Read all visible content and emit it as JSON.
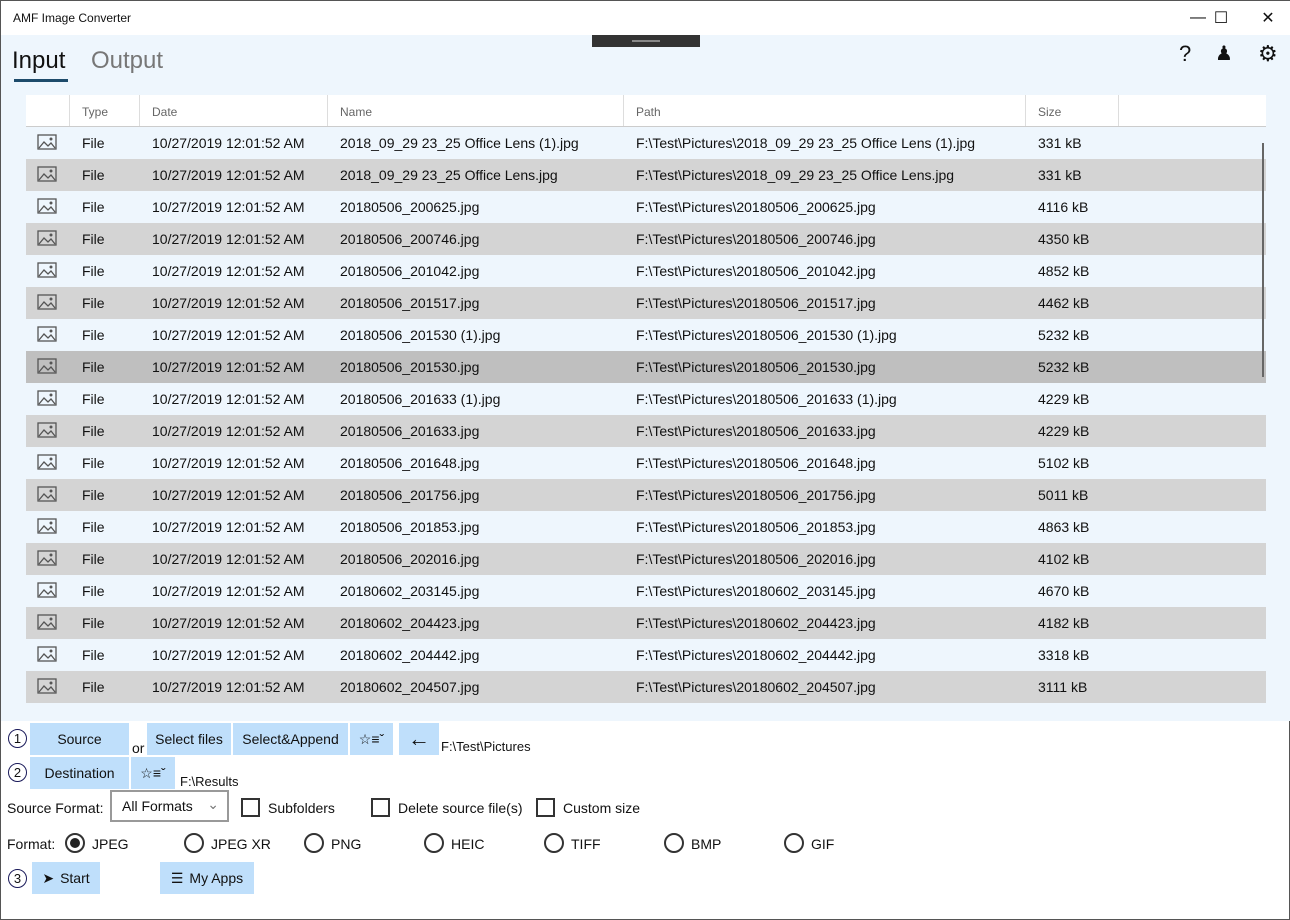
{
  "window": {
    "title": "AMF Image Converter"
  },
  "tabs": [
    {
      "label": "Input"
    },
    {
      "label": "Output"
    }
  ],
  "columns": [
    "",
    "Type",
    "Date",
    "Name",
    "Path",
    "Size"
  ],
  "rows": [
    [
      "File",
      "10/27/2019 12:01:52 AM",
      "2018_09_29 23_25 Office Lens (1).jpg",
      "F:\\Test\\Pictures\\2018_09_29 23_25 Office Lens (1).jpg",
      "331 kB"
    ],
    [
      "File",
      "10/27/2019 12:01:52 AM",
      "2018_09_29 23_25 Office Lens.jpg",
      "F:\\Test\\Pictures\\2018_09_29 23_25 Office Lens.jpg",
      "331 kB"
    ],
    [
      "File",
      "10/27/2019 12:01:52 AM",
      "20180506_200625.jpg",
      "F:\\Test\\Pictures\\20180506_200625.jpg",
      "4116 kB"
    ],
    [
      "File",
      "10/27/2019 12:01:52 AM",
      "20180506_200746.jpg",
      "F:\\Test\\Pictures\\20180506_200746.jpg",
      "4350 kB"
    ],
    [
      "File",
      "10/27/2019 12:01:52 AM",
      "20180506_201042.jpg",
      "F:\\Test\\Pictures\\20180506_201042.jpg",
      "4852 kB"
    ],
    [
      "File",
      "10/27/2019 12:01:52 AM",
      "20180506_201517.jpg",
      "F:\\Test\\Pictures\\20180506_201517.jpg",
      "4462 kB"
    ],
    [
      "File",
      "10/27/2019 12:01:52 AM",
      "20180506_201530 (1).jpg",
      "F:\\Test\\Pictures\\20180506_201530 (1).jpg",
      "5232 kB"
    ],
    [
      "File",
      "10/27/2019 12:01:52 AM",
      "20180506_201530.jpg",
      "F:\\Test\\Pictures\\20180506_201530.jpg",
      "5232 kB"
    ],
    [
      "File",
      "10/27/2019 12:01:52 AM",
      "20180506_201633 (1).jpg",
      "F:\\Test\\Pictures\\20180506_201633 (1).jpg",
      "4229 kB"
    ],
    [
      "File",
      "10/27/2019 12:01:52 AM",
      "20180506_201633.jpg",
      "F:\\Test\\Pictures\\20180506_201633.jpg",
      "4229 kB"
    ],
    [
      "File",
      "10/27/2019 12:01:52 AM",
      "20180506_201648.jpg",
      "F:\\Test\\Pictures\\20180506_201648.jpg",
      "5102 kB"
    ],
    [
      "File",
      "10/27/2019 12:01:52 AM",
      "20180506_201756.jpg",
      "F:\\Test\\Pictures\\20180506_201756.jpg",
      "5011 kB"
    ],
    [
      "File",
      "10/27/2019 12:01:52 AM",
      "20180506_201853.jpg",
      "F:\\Test\\Pictures\\20180506_201853.jpg",
      "4863 kB"
    ],
    [
      "File",
      "10/27/2019 12:01:52 AM",
      "20180506_202016.jpg",
      "F:\\Test\\Pictures\\20180506_202016.jpg",
      "4102 kB"
    ],
    [
      "File",
      "10/27/2019 12:01:52 AM",
      "20180602_203145.jpg",
      "F:\\Test\\Pictures\\20180602_203145.jpg",
      "4670 kB"
    ],
    [
      "File",
      "10/27/2019 12:01:52 AM",
      "20180602_204423.jpg",
      "F:\\Test\\Pictures\\20180602_204423.jpg",
      "4182 kB"
    ],
    [
      "File",
      "10/27/2019 12:01:52 AM",
      "20180602_204442.jpg",
      "F:\\Test\\Pictures\\20180602_204442.jpg",
      "3318 kB"
    ],
    [
      "File",
      "10/27/2019 12:01:52 AM",
      "20180602_204507.jpg",
      "F:\\Test\\Pictures\\20180602_204507.jpg",
      "3111 kB"
    ]
  ],
  "selected_row": 7,
  "steps": [
    "1",
    "2",
    "3"
  ],
  "source": {
    "button": "Source",
    "or": "or",
    "select_files": "Select files",
    "select_append": "Select&Append",
    "path": "F:\\Test\\Pictures"
  },
  "destination": {
    "button": "Destination",
    "path": "F:\\Results"
  },
  "options": {
    "source_format_label": "Source Format:",
    "source_format_value": "All Formats",
    "subfolders": "Subfolders",
    "delete_source": "Delete source file(s)",
    "custom_size": "Custom size"
  },
  "format": {
    "label": "Format:",
    "options": [
      "JPEG",
      "JPEG XR",
      "PNG",
      "HEIC",
      "TIFF",
      "BMP",
      "GIF"
    ],
    "selected": "JPEG"
  },
  "actions": {
    "start": "Start",
    "my_apps": "My Apps"
  }
}
